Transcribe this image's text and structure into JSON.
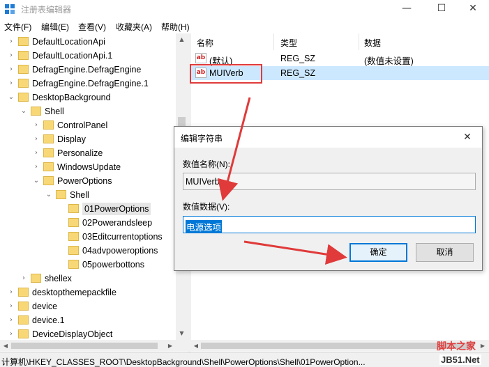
{
  "window": {
    "title": "注册表编辑器",
    "minimize_glyph": "—",
    "maximize_glyph": "☐",
    "close_glyph": "✕"
  },
  "menu": [
    "文件(F)",
    "编辑(E)",
    "查看(V)",
    "收藏夹(A)",
    "帮助(H)"
  ],
  "tree": [
    {
      "label": "DefaultLocationApi",
      "expander": "›",
      "depth": 0
    },
    {
      "label": "DefaultLocationApi.1",
      "expander": "›",
      "depth": 0
    },
    {
      "label": "DefragEngine.DefragEngine",
      "expander": "›",
      "depth": 0
    },
    {
      "label": "DefragEngine.DefragEngine.1",
      "expander": "›",
      "depth": 0
    },
    {
      "label": "DesktopBackground",
      "expander": "⌄",
      "depth": 0
    },
    {
      "label": "Shell",
      "expander": "⌄",
      "depth": 1
    },
    {
      "label": "ControlPanel",
      "expander": "›",
      "depth": 2
    },
    {
      "label": "Display",
      "expander": "›",
      "depth": 2
    },
    {
      "label": "Personalize",
      "expander": "›",
      "depth": 2
    },
    {
      "label": "WindowsUpdate",
      "expander": "›",
      "depth": 2
    },
    {
      "label": "PowerOptions",
      "expander": "⌄",
      "depth": 2
    },
    {
      "label": "Shell",
      "expander": "⌄",
      "depth": 3
    },
    {
      "label": "01PowerOptions",
      "expander": "",
      "depth": 4,
      "selected": true
    },
    {
      "label": "02Powerandsleep",
      "expander": "",
      "depth": 4
    },
    {
      "label": "03Editcurrentoptions",
      "expander": "",
      "depth": 4
    },
    {
      "label": "04advpoweroptions",
      "expander": "",
      "depth": 4
    },
    {
      "label": "05powerbottons",
      "expander": "",
      "depth": 4
    },
    {
      "label": "shellex",
      "expander": "›",
      "depth": 1
    },
    {
      "label": "desktopthemepackfile",
      "expander": "›",
      "depth": 0
    },
    {
      "label": "device",
      "expander": "›",
      "depth": 0
    },
    {
      "label": "device.1",
      "expander": "›",
      "depth": 0
    },
    {
      "label": "DeviceDisplayObject",
      "expander": "›",
      "depth": 0
    }
  ],
  "list": {
    "columns": [
      "名称",
      "类型",
      "数据"
    ],
    "rows": [
      {
        "icon": "ab",
        "name": "(默认)",
        "type": "REG_SZ",
        "data": "(数值未设置)",
        "selected": false
      },
      {
        "icon": "ab",
        "name": "MUIVerb",
        "type": "REG_SZ",
        "data": "",
        "selected": true
      }
    ]
  },
  "dialog": {
    "title": "编辑字符串",
    "close_glyph": "✕",
    "name_label": "数值名称(N):",
    "name_value": "MUIVerb",
    "data_label": "数值数据(V):",
    "data_value": "电源选项",
    "ok_label": "确定",
    "cancel_label": "取消"
  },
  "status": {
    "path": "计算机\\HKEY_CLASSES_ROOT\\DesktopBackground\\Shell\\PowerOptions\\Shell\\01PowerOption..."
  },
  "watermark": {
    "line1": "脚本之家",
    "line2": "JB51.Net"
  },
  "colors": {
    "accent": "#0078d7",
    "annotation": "#e03a3a",
    "selection": "#cce8ff",
    "folder": "#f8d876"
  }
}
